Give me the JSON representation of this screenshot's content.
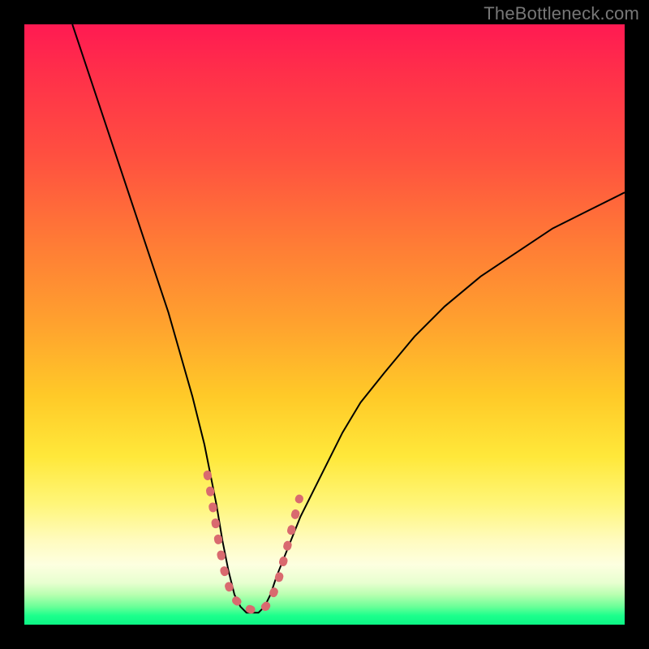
{
  "watermark_text": "TheBottleneck.com",
  "chart_data": {
    "type": "line",
    "title": "",
    "xlabel": "",
    "ylabel": "",
    "xlim": [
      0,
      100
    ],
    "ylim": [
      0,
      100
    ],
    "legend": false,
    "grid": false,
    "background_gradient": {
      "direction": "vertical",
      "stops": [
        {
          "pos": 0.0,
          "color": "#ff1a52"
        },
        {
          "pos": 0.22,
          "color": "#ff5040"
        },
        {
          "pos": 0.5,
          "color": "#ffa22e"
        },
        {
          "pos": 0.72,
          "color": "#ffe83a"
        },
        {
          "pos": 0.9,
          "color": "#fdffe0"
        },
        {
          "pos": 0.97,
          "color": "#6aff98"
        },
        {
          "pos": 1.0,
          "color": "#0cf585"
        }
      ]
    },
    "series": [
      {
        "name": "bottleneck-curve",
        "stroke": "#000000",
        "stroke_width": 2,
        "x": [
          8,
          10,
          12,
          14,
          16,
          18,
          20,
          22,
          24,
          26,
          28,
          30,
          32,
          33,
          34,
          35,
          36,
          37,
          38,
          39,
          40,
          41,
          42,
          44,
          46,
          48,
          50,
          53,
          56,
          60,
          65,
          70,
          76,
          82,
          88,
          94,
          100
        ],
        "y": [
          100,
          94,
          88,
          82,
          76,
          70,
          64,
          58,
          52,
          45,
          38,
          30,
          20,
          14,
          9,
          5,
          3,
          2,
          2,
          2,
          3,
          5,
          8,
          13,
          18,
          22,
          26,
          32,
          37,
          42,
          48,
          53,
          58,
          62,
          66,
          69,
          72
        ]
      },
      {
        "name": "highlight-trough-dots",
        "stroke": "#d96a6f",
        "stroke_width": 10,
        "linecap": "round",
        "dash": [
          2,
          18
        ],
        "x": [
          30.5,
          31.5,
          32.5,
          33.3,
          34.2,
          35.3,
          36.5,
          37.8,
          39.0,
          40.2,
          41.2,
          42.2,
          43.0,
          43.8,
          44.8,
          45.8
        ],
        "y": [
          25,
          19,
          13,
          9,
          6,
          4,
          3,
          2.5,
          2.5,
          3,
          4.5,
          7,
          10,
          13,
          17,
          21
        ]
      }
    ]
  }
}
